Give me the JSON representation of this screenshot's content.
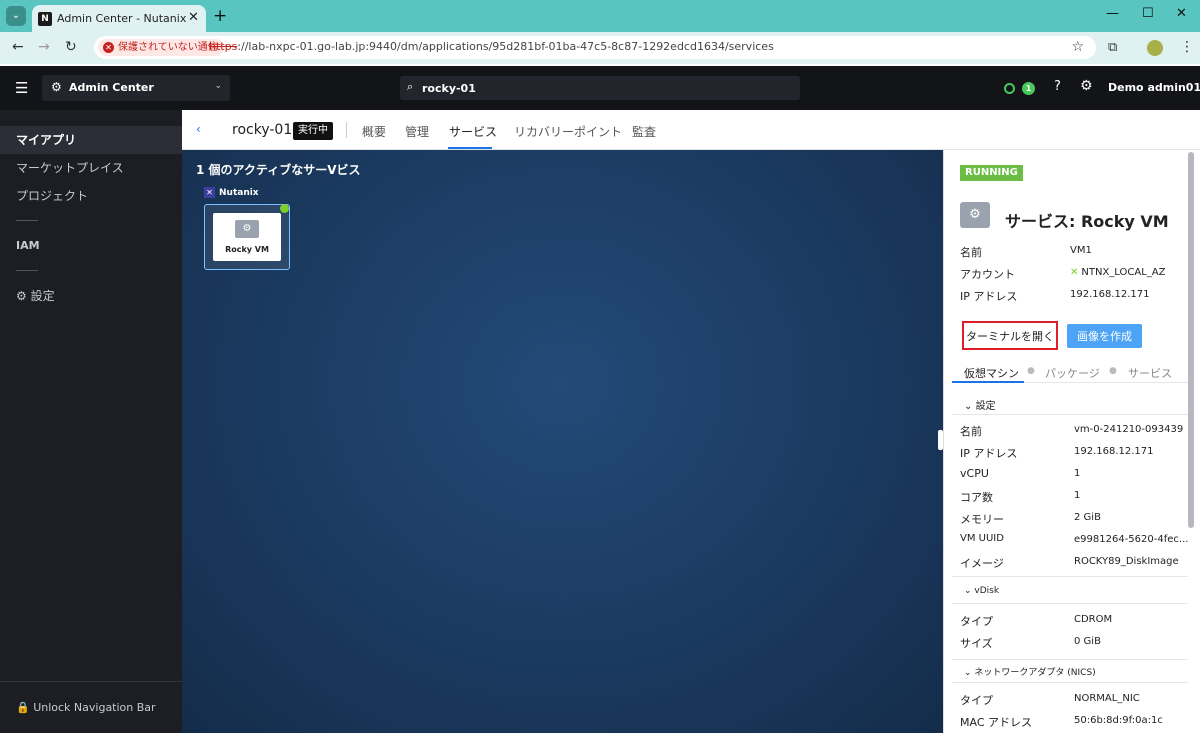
{
  "browser": {
    "tab_title": "Admin Center - Nutanix",
    "insecure_label": "保護されていない通信",
    "url_scheme": "https",
    "url_rest": "://lab-nxpc-01.go-lab.jp:9440/dm/applications/95d281bf-01ba-47c5-8c87-1292edcd1634/services"
  },
  "header": {
    "app_switcher": "Admin Center",
    "search_value": "rocky-01",
    "alert_count": "1",
    "user": "Demo admin01"
  },
  "sidebar": {
    "items": [
      "マイアプリ",
      "マーケットプレイス",
      "プロジェクト"
    ],
    "iam": "IAM",
    "settings": "設定",
    "unlock": "Unlock Navigation Bar"
  },
  "page": {
    "app_name": "rocky-01",
    "status": "実行中",
    "tabs": [
      "概要",
      "管理",
      "サービス",
      "リカバリーポイント",
      "監査"
    ]
  },
  "canvas": {
    "title": "1 個のアクティブなサーVビス",
    "provider": "Nutanix",
    "service_label": "Rocky VM"
  },
  "panel": {
    "status": "RUNNING",
    "title": "サービス: Rocky VM",
    "summary": [
      {
        "k": "名前",
        "v": "VM1"
      },
      {
        "k": "アカウント",
        "v": "NTNX_LOCAL_AZ"
      },
      {
        "k": "IP アドレス",
        "v": "192.168.12.171"
      }
    ],
    "btn_terminal": "ターミナルを開く",
    "btn_image": "画像を作成",
    "subtabs": [
      "仮想マシン",
      "パッケージ",
      "サービス"
    ],
    "section_settings": "設定",
    "settings": [
      {
        "k": "名前",
        "v": "vm-0-241210-093439"
      },
      {
        "k": "IP アドレス",
        "v": "192.168.12.171"
      },
      {
        "k": "vCPU",
        "v": "1"
      },
      {
        "k": "コア数",
        "v": "1"
      },
      {
        "k": "メモリー",
        "v": "2 GiB"
      },
      {
        "k": "VM UUID",
        "v": "e9981264-5620-4fec..."
      },
      {
        "k": "イメージ",
        "v": "ROCKY89_DiskImage"
      }
    ],
    "section_vdisk": "vDisk",
    "vdisk": [
      {
        "k": "タイプ",
        "v": "CDROM"
      },
      {
        "k": "サイズ",
        "v": "0 GiB"
      }
    ],
    "section_nics": "ネットワークアダプタ (NICS)",
    "nics": [
      {
        "k": "タイプ",
        "v": "NORMAL_NIC"
      },
      {
        "k": "MAC アドレス",
        "v": "50:6b:8d:9f:0a:1c"
      }
    ]
  }
}
